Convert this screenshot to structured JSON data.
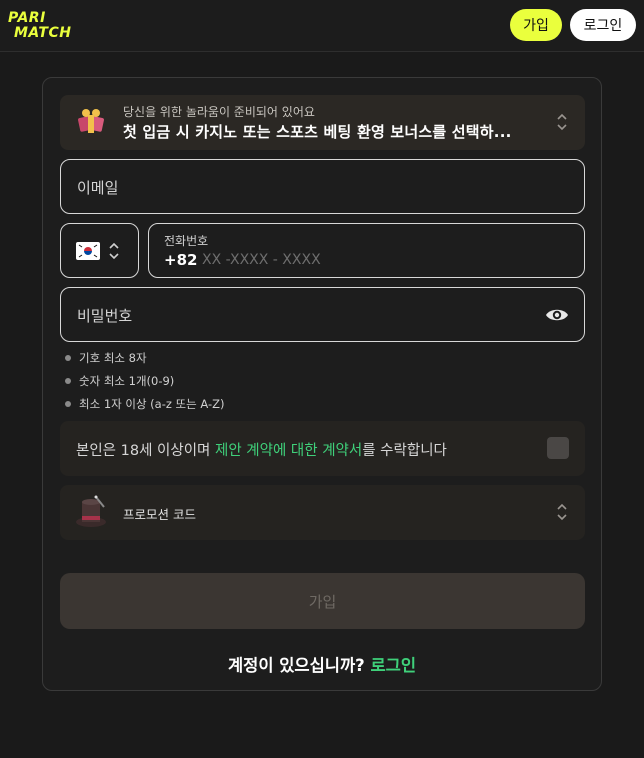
{
  "header": {
    "brand": "PARI MATCH",
    "signup_label": "가입",
    "login_label": "로그인",
    "brand_color": "#eaff3d"
  },
  "bonus": {
    "icon": "gift-icon",
    "caption": "당신을 위한 놀라움이 준비되어 있어요",
    "title": "첫 입금 시 카지노 또는 스포츠 베팅 환영 보너스를 선택하..."
  },
  "email": {
    "placeholder": "이메일"
  },
  "phone": {
    "country_flag": "south-korea-flag-icon",
    "label": "전화번호",
    "code": "+82",
    "placeholder": "XX -XXXX - XXXX"
  },
  "password": {
    "placeholder": "비밀번호",
    "rules": [
      "기호 최소 8자",
      "숫자 최소 1개(0-9)",
      "최소 1자 이상 (a-z 또는 A-Z)"
    ]
  },
  "terms": {
    "prefix": "본인은 18세 이상이며 ",
    "link": "제안 계약에 대한 계약서",
    "suffix": "를 수락합니다",
    "link_color": "#3fd07a"
  },
  "promo": {
    "icon": "magic-hat-icon",
    "label": "프로모션 코드"
  },
  "submit_label": "가입",
  "footer": {
    "question": "계정이 있으십니까?",
    "login_link": "로그인"
  }
}
